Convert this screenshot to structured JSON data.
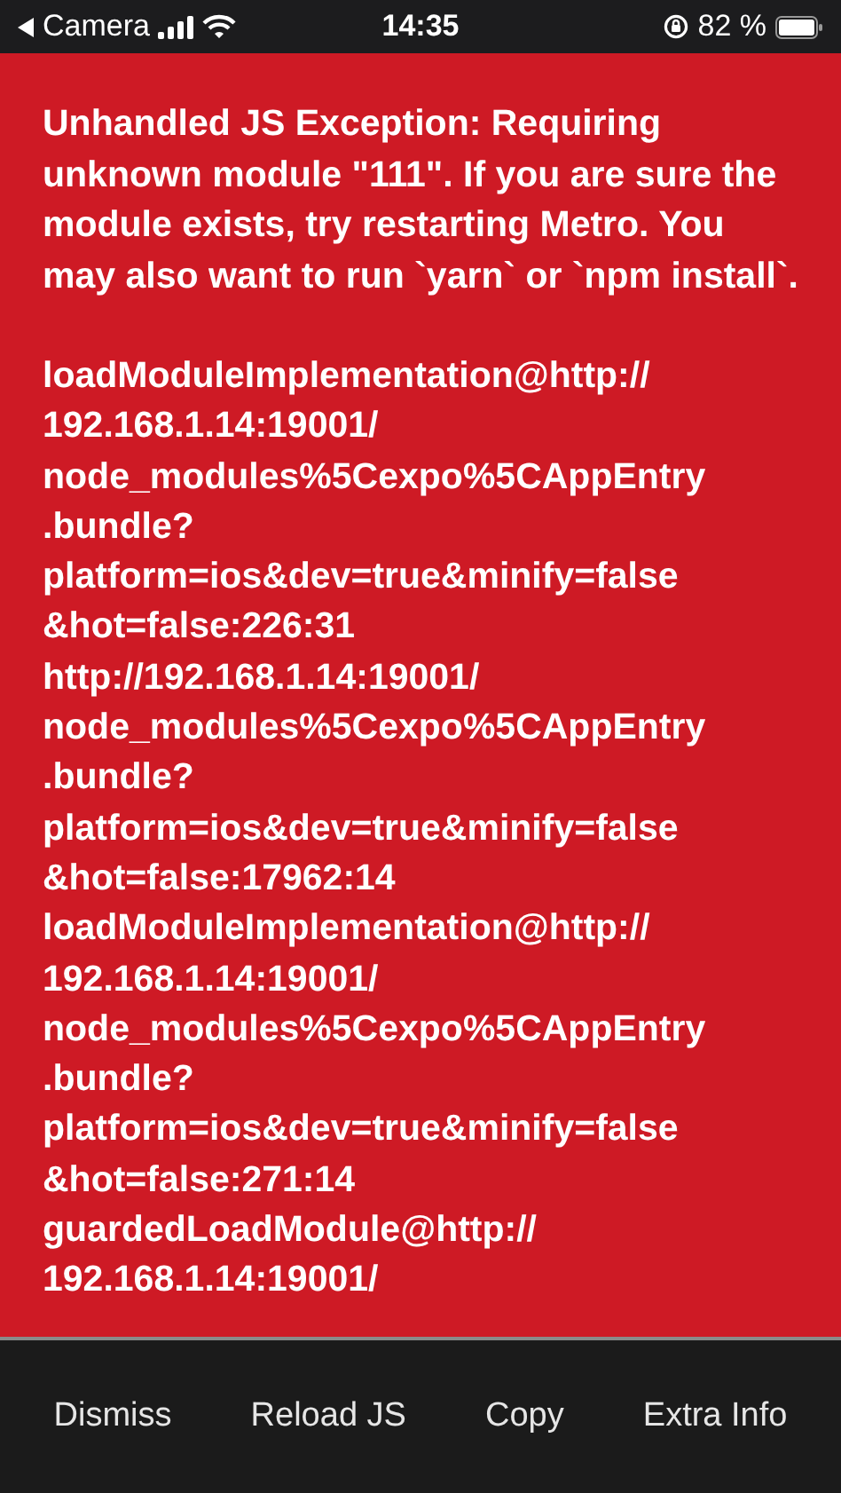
{
  "status_bar": {
    "back_label": "Camera",
    "time": "14:35",
    "battery_percent": "82 %"
  },
  "error": {
    "message": "Unhandled JS Exception: Requiring unknown module \"111\". If you are sure the module exists, try restarting Metro. You may also want to run `yarn` or `npm install`.",
    "stack_trace": [
      "loadModuleImplementation@http://",
      "192.168.1.14:19001/",
      "node_modules%5Cexpo%5CAppEntry",
      ".bundle?",
      "platform=ios&dev=true&minify=false",
      "&hot=false:226:31",
      "http://192.168.1.14:19001/",
      "node_modules%5Cexpo%5CAppEntry",
      ".bundle?",
      "platform=ios&dev=true&minify=false",
      "&hot=false:17962:14",
      "loadModuleImplementation@http://",
      "192.168.1.14:19001/",
      "node_modules%5Cexpo%5CAppEntry",
      ".bundle?",
      "platform=ios&dev=true&minify=false",
      "&hot=false:271:14",
      "guardedLoadModule@http://",
      "192.168.1.14:19001/"
    ]
  },
  "buttons": [
    "Dismiss",
    "Reload JS",
    "Copy",
    "Extra Info"
  ]
}
